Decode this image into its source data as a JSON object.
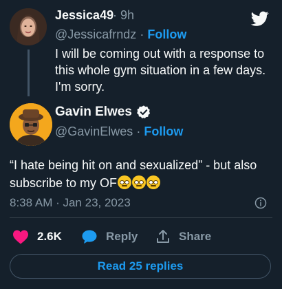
{
  "icons": {
    "brand": "twitter-bird-icon",
    "verified": "verified-badge-icon",
    "info": "info-icon",
    "like": "heart-icon",
    "reply": "speech-bubble-icon",
    "share": "share-upload-icon",
    "emoji": "rolling-eyes-emoji"
  },
  "colors": {
    "background": "#15202b",
    "accent": "#1d9bf0",
    "like": "#f91880",
    "muted": "#8899a6"
  },
  "parent_tweet": {
    "name": "Jessica49",
    "time": "· 9h",
    "handle": "@Jessicafrndz",
    "separator": "·",
    "follow_label": "Follow",
    "text": "I will be coming out with a response to this whole gym situation in a few days. I'm sorry."
  },
  "main_tweet": {
    "name": "Gavin Elwes",
    "handle": "@GavinElwes",
    "separator": "·",
    "follow_label": "Follow",
    "text": "“I hate being hit on and sexualized” - but also subscribe to my OF",
    "emoji_count": 3,
    "timestamp": "8:38 AM · Jan 23, 2023"
  },
  "actions": {
    "like_count": "2.6K",
    "reply_label": "Reply",
    "share_label": "Share"
  },
  "read_replies_label": "Read 25 replies"
}
